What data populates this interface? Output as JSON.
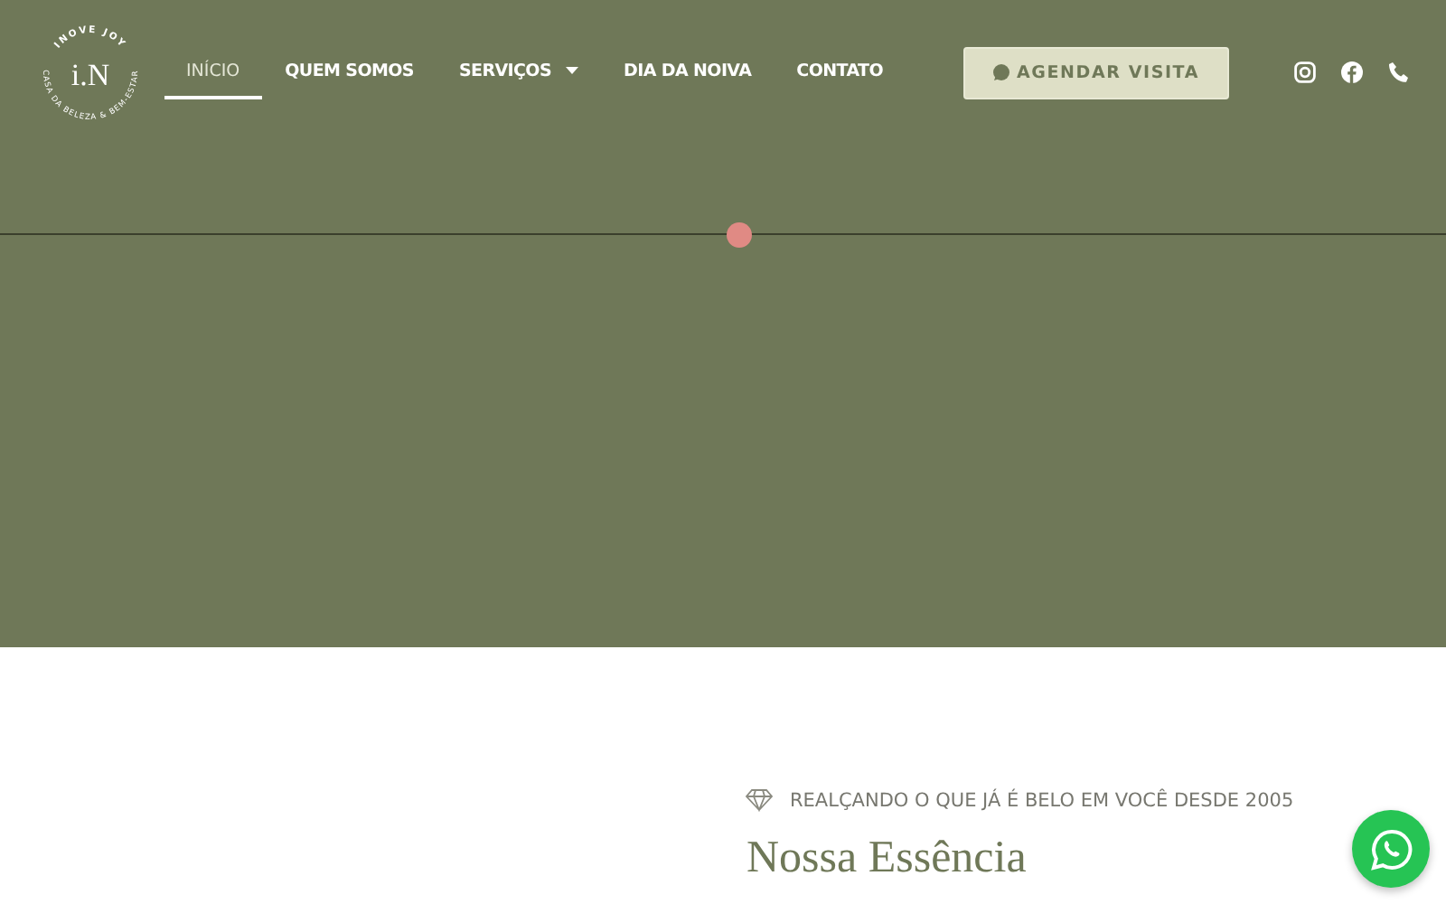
{
  "logo": {
    "monogram": "i.N",
    "arc_top": "INOVE JOY",
    "arc_bottom": "CASA DA BELEZA & BEM-ESTAR"
  },
  "nav": [
    {
      "label": "INÍCIO",
      "selected": true,
      "dropdown": false
    },
    {
      "label": "QUEM SOMOS",
      "selected": false,
      "dropdown": false
    },
    {
      "label": "SERVIÇOS",
      "selected": false,
      "dropdown": true
    },
    {
      "label": "DIA DA NOIVA",
      "selected": false,
      "dropdown": false
    },
    {
      "label": "CONTATO",
      "selected": false,
      "dropdown": false
    }
  ],
  "cta": {
    "label": "AGENDAR VISITA"
  },
  "social": [
    {
      "kind": "instagram"
    },
    {
      "kind": "facebook"
    },
    {
      "kind": "phone"
    }
  ],
  "section": {
    "eyebrow": "REALÇANDO O QUE JÁ É BELO EM VOCÊ DESDE 2005",
    "title": "Nossa Essência"
  }
}
